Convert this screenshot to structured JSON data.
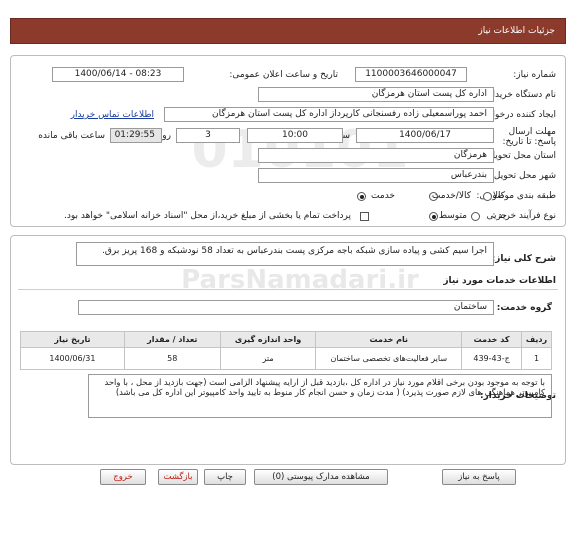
{
  "page_title": "جزئیات اطلاعات نیاز",
  "need_number_label": "شماره نیاز:",
  "need_number": "1100003646000047",
  "announce_label": "تاریخ و ساعت اعلان عمومی:",
  "announce_value": "1400/06/14 - 08:23",
  "buyer_label": "نام دستگاه خریدار:",
  "buyer_value": "اداره کل پست استان هرمزگان",
  "requester_label": "ایجاد کننده درخواست:",
  "requester_value": "احمد پوراسمعیلی زاده رفسنجانی کارپرداز اداره کل پست استان هرمزگان",
  "contact_link": "اطلاعات تماس خریدار",
  "deadline_label": "مهلت ارسال پاسخ: تا تاریخ:",
  "deadline_date": "1400/06/17",
  "hour_label": "ساعت",
  "deadline_time": "10:00",
  "days_value": "3",
  "days_label": "روز و",
  "remaining_time": "01:29:55",
  "remaining_label": "ساعت باقی مانده",
  "province_label": "استان محل تحویل:",
  "province_value": "هرمزگان",
  "city_label": "شهر محل تحویل:",
  "city_value": "بندرعباس",
  "category_label": "طبقه بندی موضوعی:",
  "category_options": [
    "کالا",
    "کالا/خدمت",
    "خدمت"
  ],
  "purchase_label": "نوع فرآیند خرید :",
  "purchase_options": [
    "جزیی",
    "متوسط"
  ],
  "purchase_note": "پرداخت تمام یا بخشی از مبلغ خرید،از محل \"اسناد خزانه اسلامی\" خواهد بود.",
  "summary_label": "شرح کلی نیاز:",
  "summary_value": "اجرا سیم کشی و پیاده سازی شبکه باجه مرکزی پست بندرعباس به تعداد 58 نودشبکه و 168 پریز برق.",
  "services_heading": "اطلاعات خدمات مورد نیاز",
  "group_label": "گروه خدمت:",
  "group_value": "ساختمان",
  "table": {
    "headers": [
      "ردیف",
      "کد خدمت",
      "نام خدمت",
      "واحد اندازه گیری",
      "تعداد / مقدار",
      "تاریخ نیاز"
    ],
    "rows": [
      [
        "1",
        "ج-43-439",
        "سایر فعالیت‌های تخصصی ساختمان",
        "متر",
        "58",
        "1400/06/31"
      ]
    ]
  },
  "buyer_notes_label": "توضیحات خریدار:",
  "buyer_notes": "با توجه به موجود بودن برخی اقلام مورد نیاز در اداره کل ،بازدید قبل از ارایه پیشنهاد الزامی است (جهت بازدید از محل ، با واحد کامپیوتر هماهنگی های لازم صورت پذیرد) ( مدت زمان و حسن انجام کار منوط به تایید واحد کامپیوتر این اداره کل می باشد)",
  "buttons": {
    "reply": "پاسخ به نیاز",
    "attachments": "مشاهده مدارک پیوستی (0)",
    "print": "چاپ",
    "back": "بازگشت",
    "exit": "خروج"
  }
}
